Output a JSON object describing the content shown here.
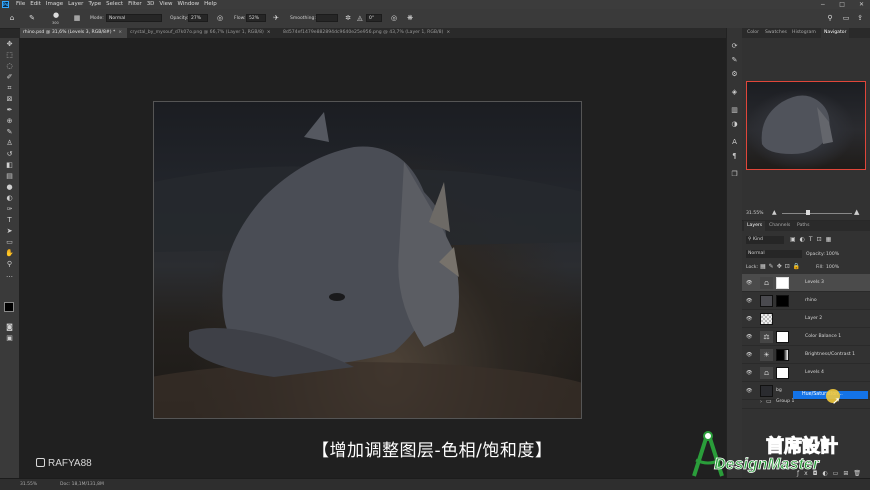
{
  "menubar": {
    "app_icon": "Ps",
    "items": [
      "File",
      "Edit",
      "Image",
      "Layer",
      "Type",
      "Select",
      "Filter",
      "3D",
      "View",
      "Window",
      "Help"
    ],
    "window_controls": [
      "−",
      "□",
      "✕"
    ]
  },
  "options": {
    "mode_label": "Mode:",
    "mode_value": "Normal",
    "opacity_label": "Opacity:",
    "opacity_value": "27%",
    "flow_label": "Flow:",
    "flow_value": "52%",
    "smoothing_label": "Smoothing:",
    "angle_value": "0°",
    "brush_size": "300"
  },
  "tabs": [
    {
      "label": "rhino.psd @ 31,6% (Levels 3, RGB/8#) *",
      "active": true
    },
    {
      "label": "crystal_by_mysouf_d7k07o.png @ 66,7% (Layer 1, RGB/8)",
      "active": false
    },
    {
      "label": "8d574ef1479e882894dc9640e25e956.png @ 43,7% (Layer 1, RGB/8)",
      "active": false
    }
  ],
  "navigator": {
    "tabs": [
      "Color",
      "Swatches",
      "Histogram",
      "Navigator"
    ],
    "active_tab": "Navigator",
    "zoom": "31.55%"
  },
  "layers_panel": {
    "tabs": [
      "Layers",
      "Channels",
      "Paths"
    ],
    "filter_kind": "Kind",
    "blend_mode": "Normal",
    "opacity_label": "Opacity:",
    "opacity_value": "100%",
    "lock_label": "Lock:",
    "fill_label": "Fill:",
    "fill_value": "100%",
    "layers": [
      {
        "name": "Levels 3",
        "type": "adjustment",
        "selected": true
      },
      {
        "name": "rhino",
        "type": "image"
      },
      {
        "name": "Layer 2",
        "type": "transparent"
      },
      {
        "name": "Color Balance 1",
        "type": "adjustment"
      },
      {
        "name": "Brightness/Contrast 1",
        "type": "adjustment"
      },
      {
        "name": "Levels 4",
        "type": "adjustment"
      },
      {
        "name": "bg",
        "type": "image"
      },
      {
        "name": "Group 1",
        "type": "group"
      }
    ],
    "popup_item": "Hue/Saturation..."
  },
  "caption": "【增加调整图层-色相/饱和度】",
  "watermark_handle": "RAFYA88",
  "logo": {
    "line1": "首席設計",
    "line2": "DesignMaster"
  },
  "status": {
    "zoom": "31.55%",
    "doc": "Doc: 18,1M/131,8M"
  },
  "colors": {
    "accent": "#1473e6",
    "navigator_frame": "#e0463a",
    "logo_green": "#2a9d3a",
    "logo_red": "#e01b24"
  }
}
